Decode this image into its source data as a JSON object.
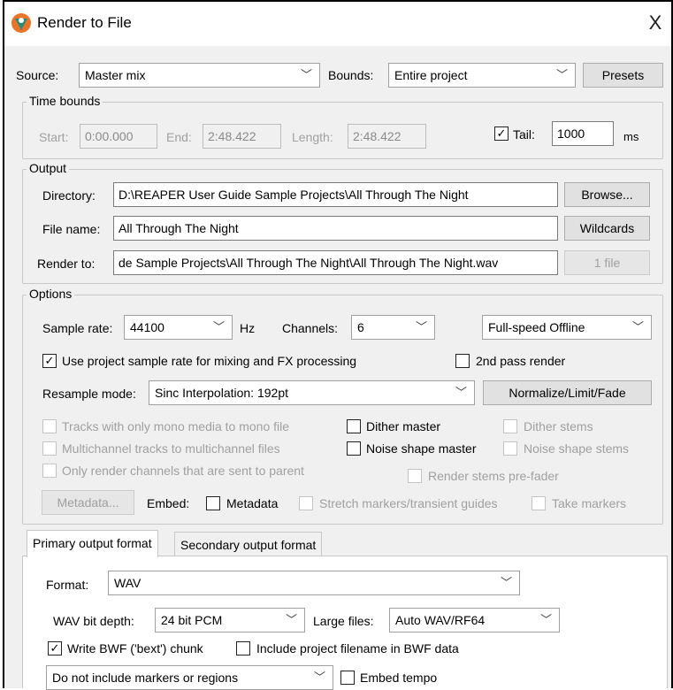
{
  "window": {
    "title": "Render to File",
    "icon": "reaper-logo-icon",
    "close_label": "X"
  },
  "top": {
    "source_label": "Source:",
    "source_value": "Master mix",
    "bounds_label": "Bounds:",
    "bounds_value": "Entire project",
    "presets_label": "Presets"
  },
  "time_bounds": {
    "title": "Time bounds",
    "start_label": "Start:",
    "start_value": "0:00.000",
    "end_label": "End:",
    "end_value": "2:48.422",
    "length_label": "Length:",
    "length_value": "2:48.422",
    "tail_label": "Tail:",
    "tail_checked": true,
    "tail_value": "1000",
    "tail_unit": "ms"
  },
  "output": {
    "title": "Output",
    "directory_label": "Directory:",
    "directory_value": "D:\\REAPER User Guide Sample Projects\\All Through The Night",
    "browse_label": "Browse...",
    "filename_label": "File name:",
    "filename_value": "All Through The Night",
    "wildcards_label": "Wildcards",
    "renderto_label": "Render to:",
    "renderto_value": "de Sample Projects\\All Through The Night\\All Through The Night.wav",
    "files_label": "1 file"
  },
  "options": {
    "title": "Options",
    "sample_rate_label": "Sample rate:",
    "sample_rate_value": "44100",
    "hz_label": "Hz",
    "channels_label": "Channels:",
    "channels_value": "6",
    "speed_value": "Full-speed Offline",
    "use_project_rate_label": "Use project sample rate for mixing and FX processing",
    "use_project_rate_checked": true,
    "second_pass_label": "2nd pass render",
    "resample_label": "Resample mode:",
    "resample_value": "Sinc Interpolation: 192pt",
    "normalize_label": "Normalize/Limit/Fade",
    "mono_label": "Tracks with only mono media to mono file",
    "dither_master_label": "Dither master",
    "dither_stems_label": "Dither stems",
    "multichannel_label": "Multichannel tracks to multichannel files",
    "noise_master_label": "Noise shape master",
    "noise_stems_label": "Noise shape stems",
    "only_parent_label": "Only render channels that are sent to parent",
    "stems_prefader_label": "Render stems pre-fader",
    "metadata_button_label": "Metadata...",
    "embed_label": "Embed:",
    "embed_metadata_label": "Metadata",
    "stretch_markers_label": "Stretch markers/transient guides",
    "take_markers_label": "Take markers"
  },
  "tabs": [
    {
      "label": "Primary output format",
      "active": true
    },
    {
      "label": "Secondary output format",
      "active": false
    }
  ],
  "format": {
    "format_label": "Format:",
    "format_value": "WAV",
    "bit_depth_label": "WAV bit depth:",
    "bit_depth_value": "24 bit PCM",
    "large_files_label": "Large files:",
    "large_files_value": "Auto WAV/RF64",
    "bwf_label": "Write BWF ('bext') chunk",
    "bwf_checked": true,
    "include_filename_label": "Include project filename in BWF data",
    "markers_value": "Do not include markers or regions",
    "embed_tempo_label": "Embed tempo"
  },
  "colors": {
    "accent": "#f0f0f0",
    "logo_orange": "#e8742a",
    "logo_teal": "#2a8a7a"
  }
}
